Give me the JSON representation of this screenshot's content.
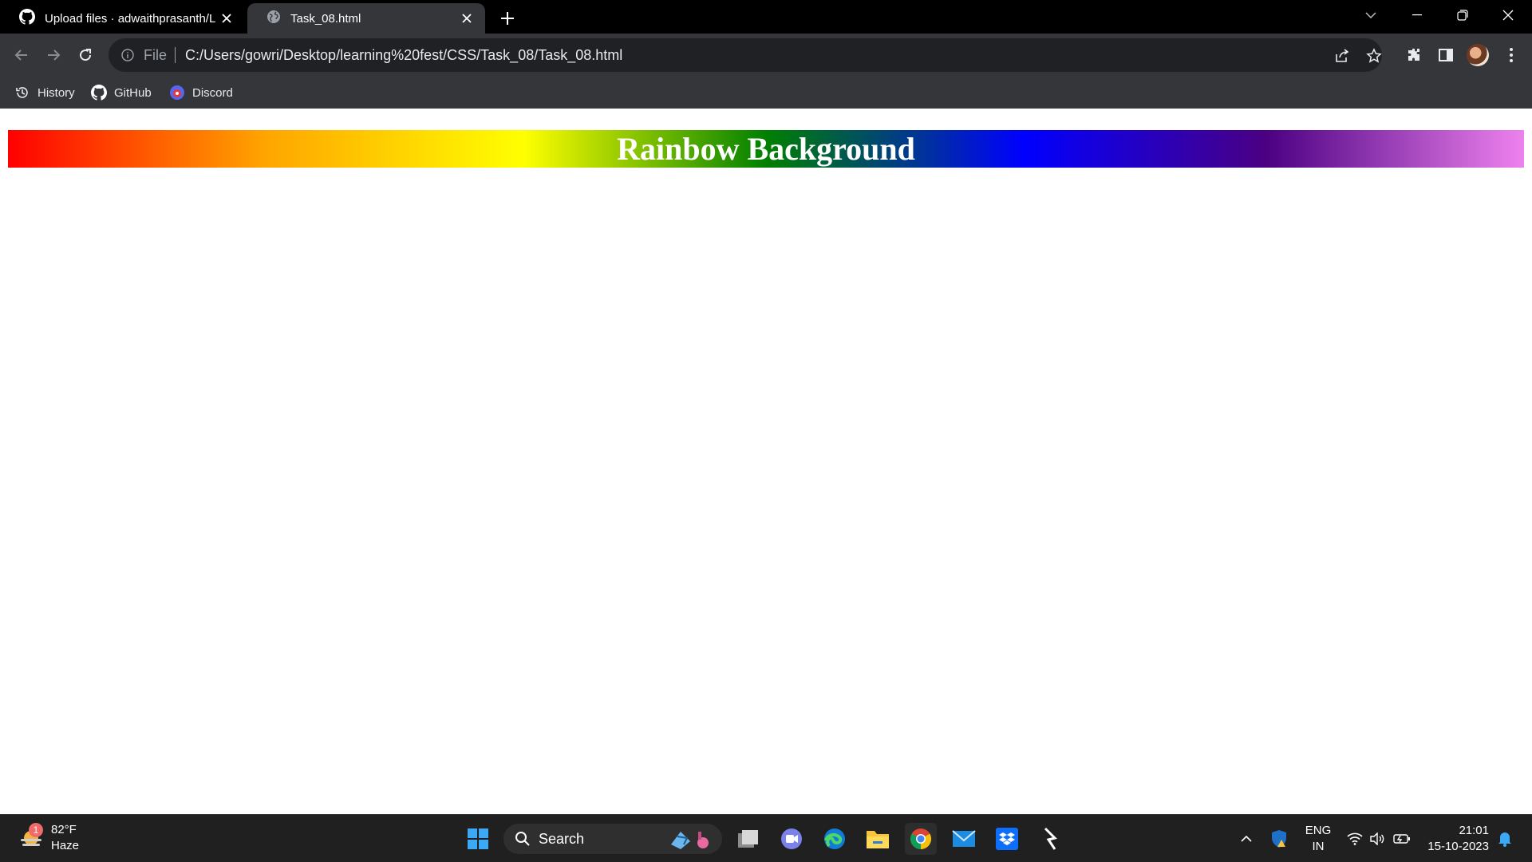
{
  "browser": {
    "tabs": [
      {
        "title": "Upload files · adwaithprasanth/L",
        "icon": "github-icon",
        "active": false
      },
      {
        "title": "Task_08.html",
        "icon": "globe-icon",
        "active": true
      }
    ],
    "omnibox": {
      "scheme_label": "File",
      "url": "C:/Users/gowri/Desktop/learning%20fest/CSS/Task_08/Task_08.html"
    },
    "bookmarks": [
      {
        "label": "History",
        "icon": "history-icon"
      },
      {
        "label": "GitHub",
        "icon": "github-icon"
      },
      {
        "label": "Discord",
        "icon": "discord-icon"
      }
    ]
  },
  "page": {
    "heading": "Rainbow Background",
    "heading_color": "#ffffff",
    "gradient_colors": [
      "#ff0000",
      "#ffa500",
      "#ffff00",
      "#008000",
      "#0000ff",
      "#4b0082",
      "#ee82ee"
    ]
  },
  "taskbar": {
    "weather": {
      "temp": "82°F",
      "condition": "Haze",
      "badge": "1"
    },
    "search_label": "Search",
    "pinned_apps": [
      "windows-start-icon",
      "file-view-icon",
      "teams-icon",
      "edge-icon",
      "file-explorer-icon",
      "chrome-icon",
      "mail-icon",
      "dropbox-icon",
      "terminal-icon"
    ],
    "language": {
      "line1": "ENG",
      "line2": "IN"
    },
    "time": "21:01",
    "date": "15-10-2023"
  }
}
